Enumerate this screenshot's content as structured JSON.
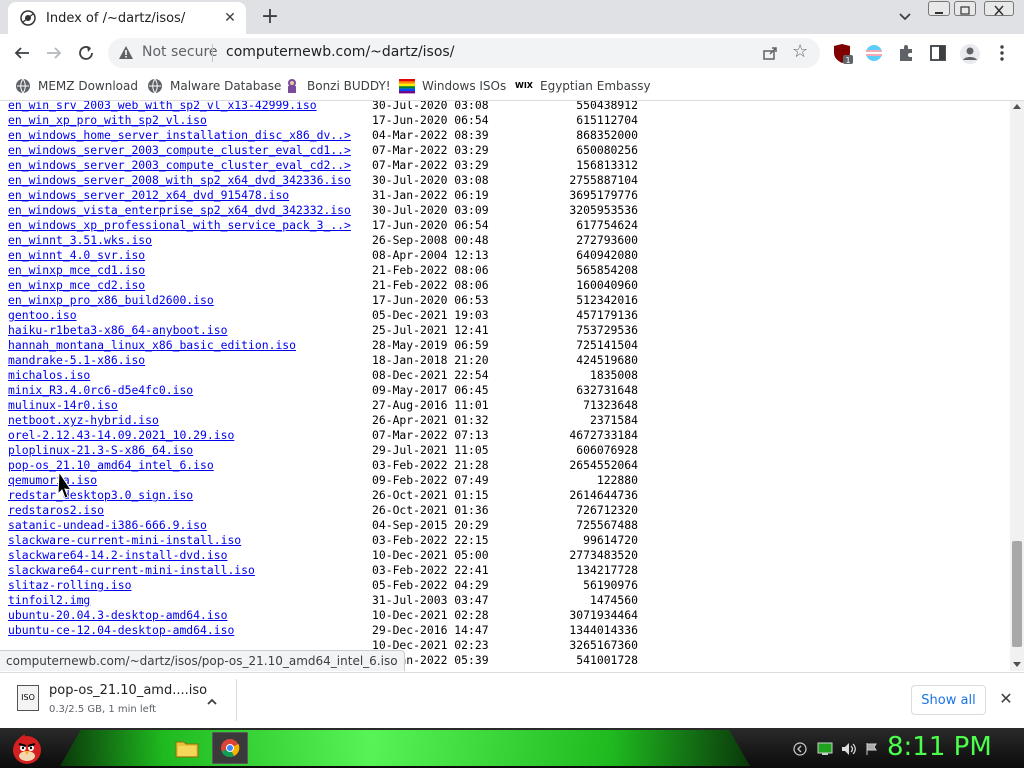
{
  "tab": {
    "title": "Index of /~dartz/isos/",
    "close": "✕",
    "new_tab": "+"
  },
  "toolbar": {
    "not_secure": "Not secure",
    "url": "computernewb.com/~dartz/isos/",
    "ext_badge": "1"
  },
  "bookmarks": [
    {
      "label": "MEMZ Download",
      "icon": "globe-icon"
    },
    {
      "label": "Malware Database",
      "icon": "globe-icon"
    },
    {
      "label": "Bonzi BUDDY!",
      "icon": "bonzi-icon"
    },
    {
      "label": "Windows ISOs",
      "icon": "windows-flag-icon"
    },
    {
      "label": "Egyptian Embassy",
      "icon": "wix-icon"
    }
  ],
  "wix_text": "WIX",
  "files": [
    {
      "name": "en_win_srv_2003_web_with_sp2_vl_x13-42999.iso",
      "date": "30-Jul-2020 03:08",
      "size": "550438912"
    },
    {
      "name": "en_win_xp_pro_with_sp2_vl.iso",
      "date": "17-Jun-2020 06:54",
      "size": "615112704"
    },
    {
      "name": "en_windows_home_server_installation_disc_x86_dv..>",
      "date": "04-Mar-2022 08:39",
      "size": "868352000"
    },
    {
      "name": "en_windows_server_2003_compute_cluster_eval_cd1..>",
      "date": "07-Mar-2022 03:29",
      "size": "650080256"
    },
    {
      "name": "en_windows_server_2003_compute_cluster_eval_cd2..>",
      "date": "07-Mar-2022 03:29",
      "size": "156813312"
    },
    {
      "name": "en_windows_server_2008_with_sp2_x64_dvd_342336.iso",
      "date": "30-Jul-2020 03:08",
      "size": "2755887104"
    },
    {
      "name": "en_windows_server_2012_x64_dvd_915478.iso",
      "date": "31-Jan-2022 06:19",
      "size": "3695179776"
    },
    {
      "name": "en_windows_vista_enterprise_sp2_x64_dvd_342332.iso",
      "date": "30-Jul-2020 03:09",
      "size": "3205953536"
    },
    {
      "name": "en_windows_xp_professional_with_service_pack_3_..>",
      "date": "17-Jun-2020 06:54",
      "size": "617754624"
    },
    {
      "name": "en_winnt_3.51.wks.iso",
      "date": "26-Sep-2008 00:48",
      "size": "272793600"
    },
    {
      "name": "en_winnt_4.0_svr.iso",
      "date": "08-Apr-2004 12:13",
      "size": "640942080"
    },
    {
      "name": "en_winxp_mce_cd1.iso",
      "date": "21-Feb-2022 08:06",
      "size": "565854208"
    },
    {
      "name": "en_winxp_mce_cd2.iso",
      "date": "21-Feb-2022 08:06",
      "size": "160040960"
    },
    {
      "name": "en_winxp_pro_x86_build2600.iso",
      "date": "17-Jun-2020 06:53",
      "size": "512342016"
    },
    {
      "name": "gentoo.iso",
      "date": "05-Dec-2021 19:03",
      "size": "457179136"
    },
    {
      "name": "haiku-r1beta3-x86_64-anyboot.iso",
      "date": "25-Jul-2021 12:41",
      "size": "753729536"
    },
    {
      "name": "hannah_montana_linux_x86_basic_edition.iso",
      "date": "28-May-2019 06:59",
      "size": "725141504"
    },
    {
      "name": "mandrake-5.1-x86.iso",
      "date": "18-Jan-2018 21:20",
      "size": "424519680"
    },
    {
      "name": "michalos.iso",
      "date": "08-Dec-2021 22:54",
      "size": "1835008"
    },
    {
      "name": "minix_R3.4.0rc6-d5e4fc0.iso",
      "date": "09-May-2017 06:45",
      "size": "632731648"
    },
    {
      "name": "mulinux-14r0.iso",
      "date": "27-Aug-2016 11:01",
      "size": "71323648"
    },
    {
      "name": "netboot.xyz-hybrid.iso",
      "date": "26-Apr-2021 01:32",
      "size": "2371584"
    },
    {
      "name": "orel-2.12.43-14.09.2021_10.29.iso",
      "date": "07-Mar-2022 07:13",
      "size": "4672733184"
    },
    {
      "name": "ploplinux-21.3-S-x86_64.iso",
      "date": "29-Jul-2021 11:05",
      "size": "606076928"
    },
    {
      "name": "pop-os_21.10_amd64_intel_6.iso",
      "date": "03-Feb-2022 21:28",
      "size": "2654552064"
    },
    {
      "name": "qemumoria.iso",
      "date": "09-Feb-2022 07:49",
      "size": "122880"
    },
    {
      "name": "redstar_desktop3.0_sign.iso",
      "date": "26-Oct-2021 01:15",
      "size": "2614644736"
    },
    {
      "name": "redstaros2.iso",
      "date": "26-Oct-2021 01:36",
      "size": "726712320"
    },
    {
      "name": "satanic-undead-i386-666.9.iso",
      "date": "04-Sep-2015 20:29",
      "size": "725567488"
    },
    {
      "name": "slackware-current-mini-install.iso",
      "date": "03-Feb-2022 22:15",
      "size": "99614720"
    },
    {
      "name": "slackware64-14.2-install-dvd.iso",
      "date": "10-Dec-2021 05:00",
      "size": "2773483520"
    },
    {
      "name": "slackware64-current-mini-install.iso",
      "date": "03-Feb-2022 22:41",
      "size": "134217728"
    },
    {
      "name": "slitaz-rolling.iso",
      "date": "05-Feb-2022 04:29",
      "size": "56190976"
    },
    {
      "name": "tinfoil2.img",
      "date": "31-Jul-2003 03:47",
      "size": "1474560"
    },
    {
      "name": "ubuntu-20.04.3-desktop-amd64.iso",
      "date": "10-Dec-2021 02:28",
      "size": "3071934464"
    },
    {
      "name": "ubuntu-ce-12.04-desktop-amd64.iso",
      "date": "29-Dec-2016 14:47",
      "size": "1344014336"
    },
    {
      "name": "",
      "date": "10-Dec-2021 02:23",
      "size": "3265167360"
    },
    {
      "name": "",
      "date": "13-Jan-2022 05:39",
      "size": "541001728"
    }
  ],
  "status_url": "computernewb.com/~dartz/isos/pop-os_21.10_amd64_intel_6.iso",
  "download": {
    "icon_text": "ISO",
    "filename": "pop-os_21.10_amd....iso",
    "status": "0.3/2.5 GB, 1 min left",
    "show_all": "Show all",
    "close": "✕"
  },
  "taskbar": {
    "clock": "8:11 PM"
  },
  "colors": {
    "link": "#0000ee",
    "clock": "#4cff4c",
    "accent": "#1a73e8"
  }
}
